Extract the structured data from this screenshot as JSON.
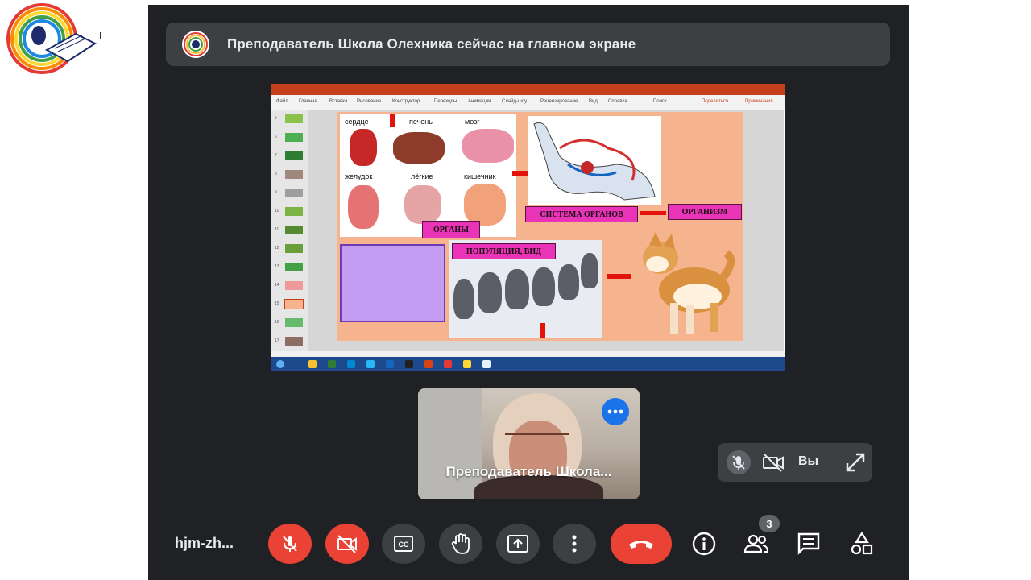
{
  "banner": {
    "text": "Преподаватель Школа Олехника сейчас на главном экране",
    "avatar_icon": "presenter-avatar-icon"
  },
  "shared_screen": {
    "ribbon_tabs": [
      "Файл",
      "Главная",
      "Вставка",
      "Рисование",
      "Конструктор",
      "Переходы",
      "Анимация",
      "Слайд-шоу",
      "Рецензирование",
      "Вид",
      "Справка",
      "Поиск"
    ],
    "ribbon_right": [
      "Поделиться",
      "Примечания"
    ],
    "slide_numbers": [
      "5",
      "6",
      "7",
      "8",
      "9",
      "10",
      "11",
      "12",
      "13",
      "14",
      "15",
      "16",
      "17"
    ],
    "organ_labels": [
      "сердце",
      "печень",
      "мозг",
      "желудок",
      "лёгкие",
      "кишечник"
    ],
    "label_organs": "ОРГАНЫ",
    "label_system": "СИСТЕМА ОРГАНОВ",
    "label_organism": "ОРГАНИЗМ",
    "label_population": "ПОПУЛЯЦИЯ, ВИД",
    "accent_color": "#ea34b7"
  },
  "presenter": {
    "name": "Преподаватель Школа..."
  },
  "self": {
    "label": "Вы"
  },
  "controls": {
    "meeting_code": "hjm-zh...",
    "participants_count": "3"
  },
  "colors": {
    "meet_background": "#202124",
    "control_gray": "#3c4043",
    "control_red": "#ea4335",
    "accent_blue": "#1a73e8"
  }
}
